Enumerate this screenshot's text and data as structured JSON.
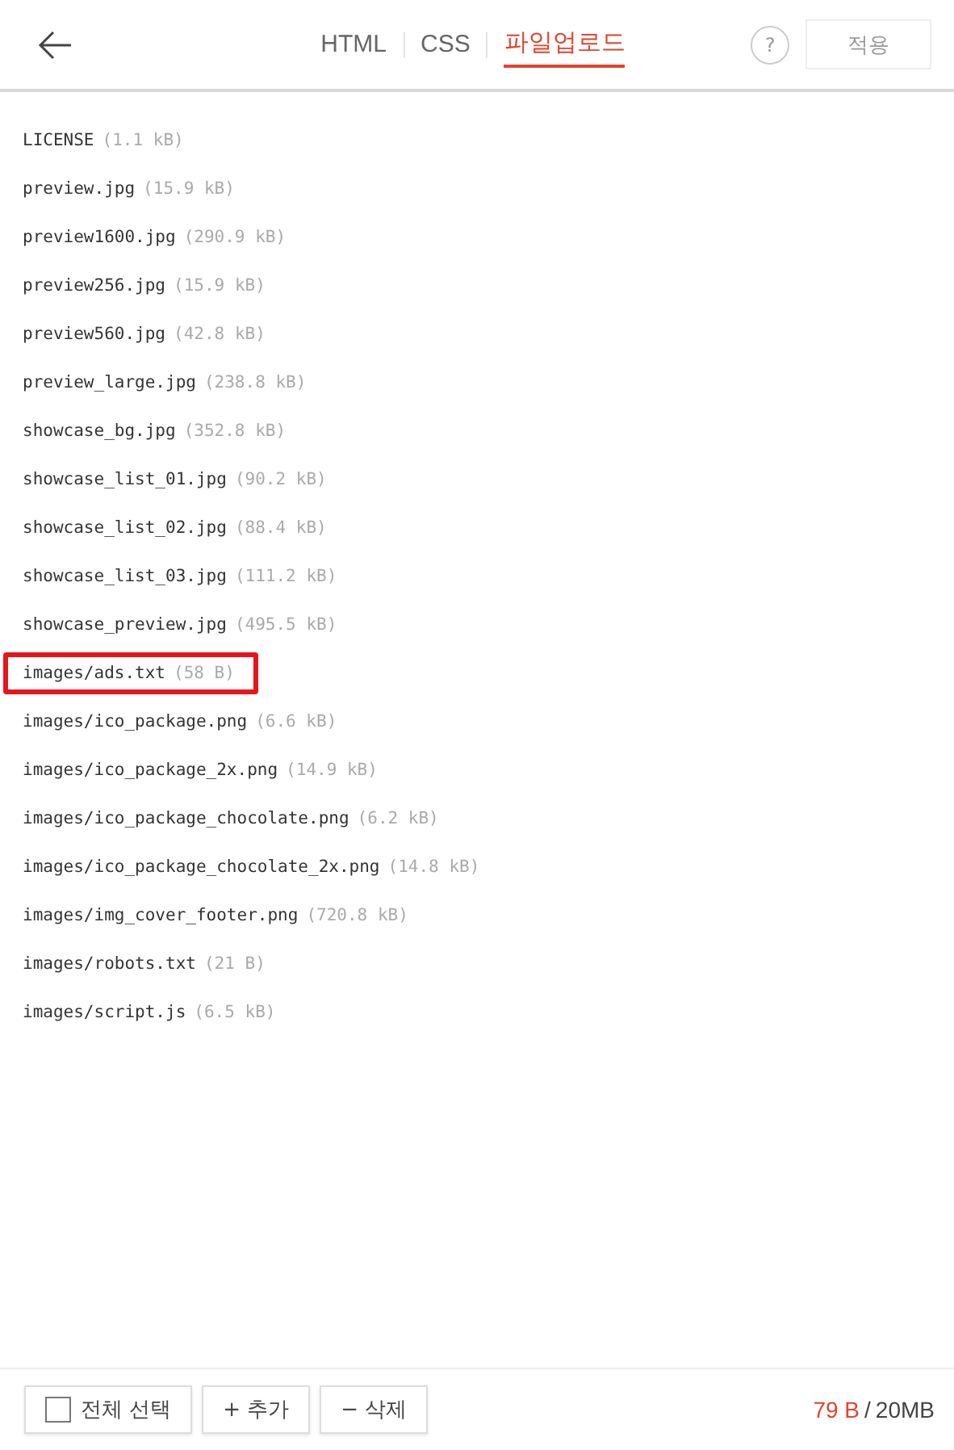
{
  "header": {
    "tabs": [
      {
        "label": "HTML",
        "selected": false
      },
      {
        "label": "CSS",
        "selected": false
      },
      {
        "label": "파일업로드",
        "selected": true
      }
    ],
    "help": "?",
    "apply_button": "적용"
  },
  "files": [
    {
      "name": "LICENSE",
      "size": "(1.1 kB)",
      "selected": false
    },
    {
      "name": "preview.jpg",
      "size": "(15.9 kB)",
      "selected": false
    },
    {
      "name": "preview1600.jpg",
      "size": "(290.9 kB)",
      "selected": false
    },
    {
      "name": "preview256.jpg",
      "size": "(15.9 kB)",
      "selected": false
    },
    {
      "name": "preview560.jpg",
      "size": "(42.8 kB)",
      "selected": false
    },
    {
      "name": "preview_large.jpg",
      "size": "(238.8 kB)",
      "selected": false
    },
    {
      "name": "showcase_bg.jpg",
      "size": "(352.8 kB)",
      "selected": false
    },
    {
      "name": "showcase_list_01.jpg",
      "size": "(90.2 kB)",
      "selected": false
    },
    {
      "name": "showcase_list_02.jpg",
      "size": "(88.4 kB)",
      "selected": false
    },
    {
      "name": "showcase_list_03.jpg",
      "size": "(111.2 kB)",
      "selected": false
    },
    {
      "name": "showcase_preview.jpg",
      "size": "(495.5 kB)",
      "selected": false
    },
    {
      "name": "images/ads.txt",
      "size": "(58 B)",
      "selected": true
    },
    {
      "name": "images/ico_package.png",
      "size": "(6.6 kB)",
      "selected": false
    },
    {
      "name": "images/ico_package_2x.png",
      "size": "(14.9 kB)",
      "selected": false
    },
    {
      "name": "images/ico_package_chocolate.png",
      "size": "(6.2 kB)",
      "selected": false
    },
    {
      "name": "images/ico_package_chocolate_2x.png",
      "size": "(14.8 kB)",
      "selected": false
    },
    {
      "name": "images/img_cover_footer.png",
      "size": "(720.8 kB)",
      "selected": false
    },
    {
      "name": "images/robots.txt",
      "size": "(21 B)",
      "selected": false
    },
    {
      "name": "images/script.js",
      "size": "(6.5 kB)",
      "selected": false
    }
  ],
  "footer": {
    "select_all": {
      "label": "전체 선택",
      "checked": false
    },
    "add_button": "+ 추가",
    "delete_button": "− 삭제",
    "used": "79 B",
    "separator": "/",
    "limit": "20MB"
  }
}
